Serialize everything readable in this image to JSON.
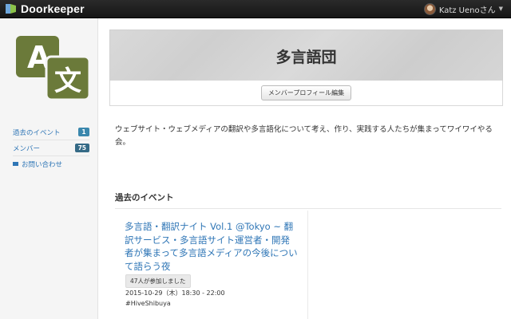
{
  "header": {
    "brand": "Doorkeeper",
    "user_name": "Katz Uenoさん"
  },
  "sidebar": {
    "items": [
      {
        "label": "過去のイベント",
        "count": "1"
      },
      {
        "label": "メンバー",
        "count": "75"
      },
      {
        "label": "お問い合わせ"
      }
    ]
  },
  "group": {
    "title": "多言語団",
    "edit_button": "メンバープロフィール編集",
    "description": "ウェブサイト・ウェブメディアの翻訳や多言語化について考え、作り、実践する人たちが集まってワイワイやる会。"
  },
  "past_events": {
    "heading": "過去のイベント",
    "events": [
      {
        "title": "多言語・翻訳ナイト Vol.1 @Tokyo ~ 翻訳サービス・多言語サイト運営者・開発者が集まって多言語メディアの今後について語らう夜",
        "participants": "47人が参加しました",
        "date": "2015-10-29（木）18:30 - 22:00",
        "venue": "#HiveShibuya"
      }
    ]
  },
  "colors": {
    "link": "#2f76b6",
    "badge": "#3a87ad",
    "logo_green": "#6b7a3a",
    "topbar": "#1c1c1c"
  }
}
